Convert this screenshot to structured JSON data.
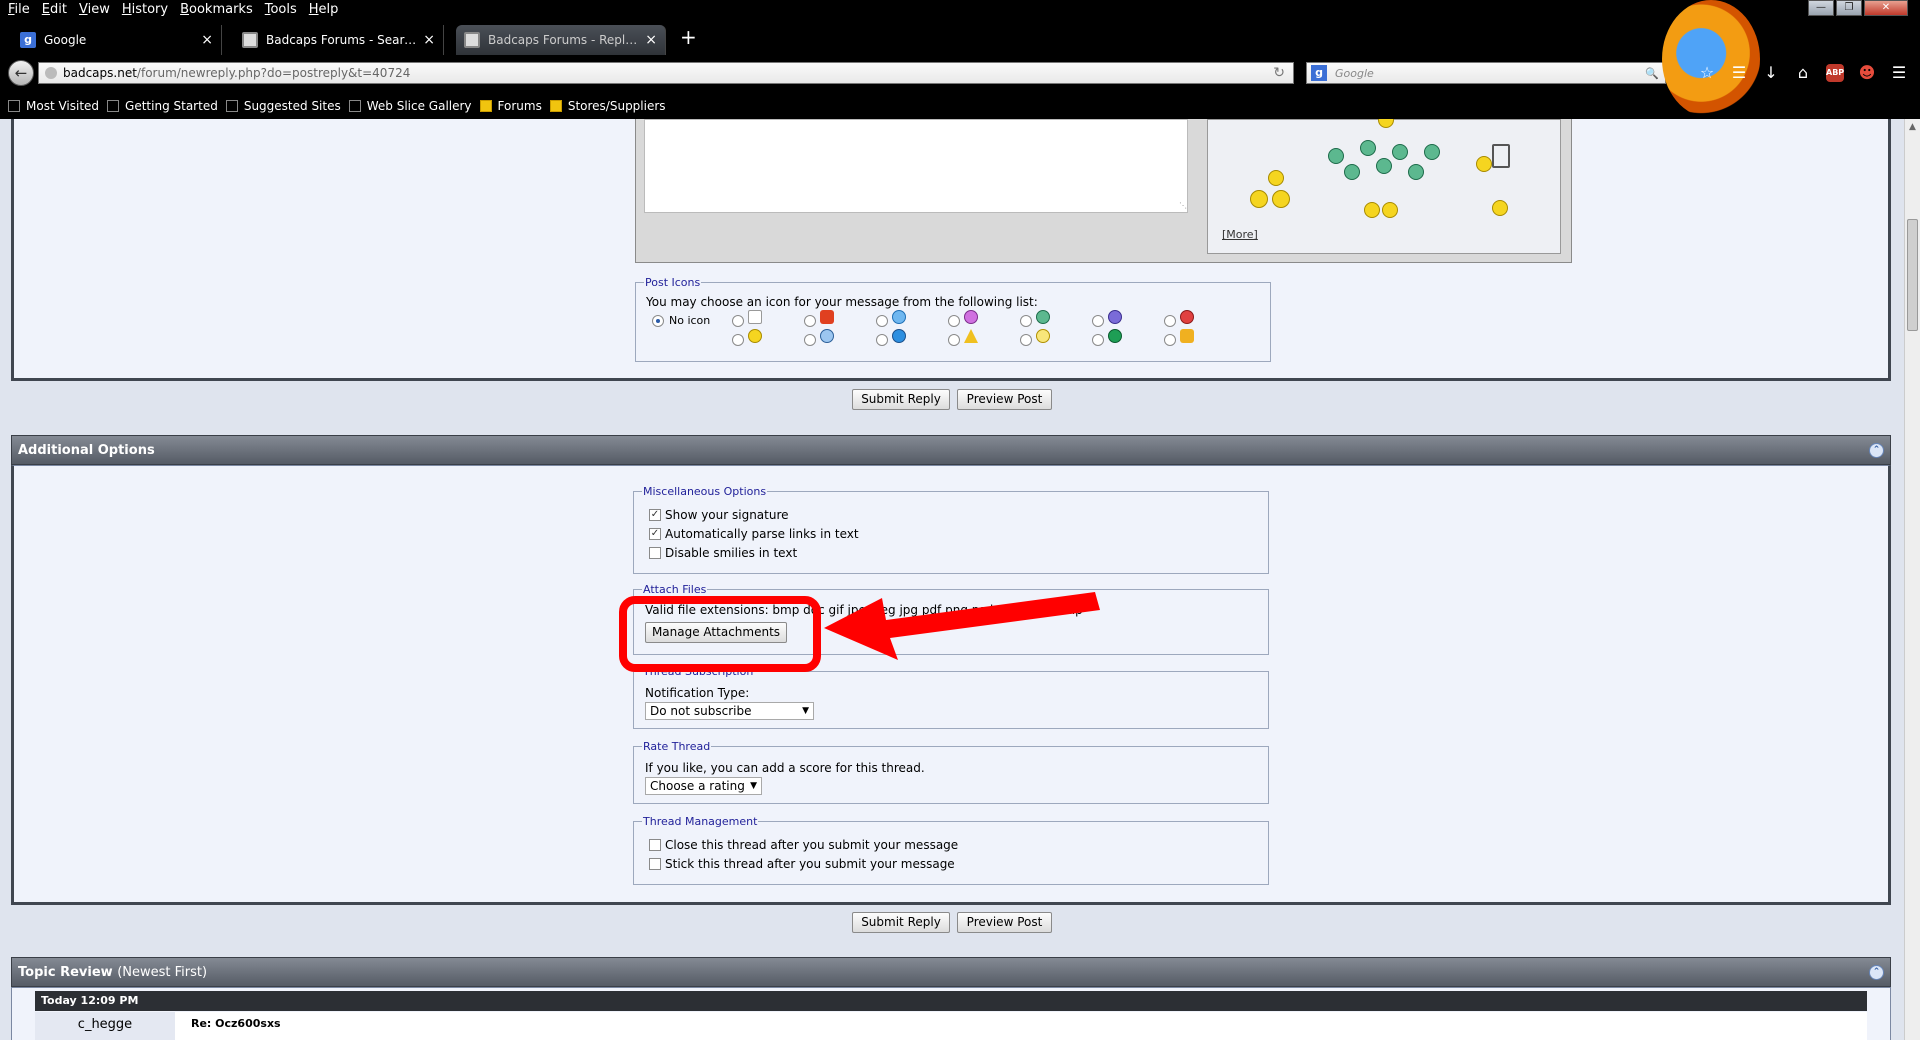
{
  "menubar": {
    "items": [
      {
        "label_u": "F",
        "label_rest": "ile"
      },
      {
        "label_u": "E",
        "label_rest": "dit"
      },
      {
        "label_u": "V",
        "label_rest": "iew"
      },
      {
        "label_u": "H",
        "label_rest": "istory"
      },
      {
        "label_u": "B",
        "label_rest": "ookmarks"
      },
      {
        "label_u": "T",
        "label_rest": "ools"
      },
      {
        "label_u": "H",
        "label_rest": "elp"
      }
    ]
  },
  "tabs": [
    {
      "title": "Google"
    },
    {
      "title": "Badcaps Forums - Search R..."
    },
    {
      "title": "Badcaps Forums - Reply to..."
    }
  ],
  "urlbar": {
    "host": "badcaps.net",
    "path": "/forum/newreply.php?do=postreply&t=40724"
  },
  "searchbar": {
    "placeholder": "Google"
  },
  "bookmarks": [
    "Most Visited",
    "Getting Started",
    "Suggested Sites",
    "Web Slice Gallery",
    "Forums",
    "Stores/Suppliers"
  ],
  "smilies": {
    "more_link": "[More]"
  },
  "post_icons": {
    "legend": "Post Icons",
    "prompt": "You may choose an icon for your message from the following list:",
    "no_icon": "No icon"
  },
  "buttons": {
    "submit": "Submit Reply",
    "preview": "Preview Post"
  },
  "additional": {
    "title": "Additional Options"
  },
  "misc": {
    "legend": "Miscellaneous Options",
    "options": [
      {
        "label": "Show your signature",
        "checked": true
      },
      {
        "label": "Automatically parse links in text",
        "checked": true
      },
      {
        "label": "Disable smilies in text",
        "checked": false
      }
    ]
  },
  "attach": {
    "legend": "Attach Files",
    "valid_label": "Valid file extensions: bmp doc gif jpe jpeg jpg pdf png psd txt xls xlsx zip",
    "manage_button": "Manage Attachments"
  },
  "subscription": {
    "legend": "Thread Subscription",
    "label": "Notification Type:",
    "selected": "Do not subscribe"
  },
  "rate": {
    "legend": "Rate Thread",
    "label": "If you like, you can add a score for this thread.",
    "selected": "Choose a rating"
  },
  "management": {
    "legend": "Thread Management",
    "options": [
      {
        "label": "Close this thread after you submit your message",
        "checked": false
      },
      {
        "label": "Stick this thread after you submit your message",
        "checked": false
      }
    ]
  },
  "topic_review": {
    "title": "Topic Review",
    "subtitle": "(Newest First)",
    "post_date": "Today 12:09 PM",
    "post_author": "c_hegge",
    "post_title": "Re: Ocz600sxs"
  },
  "colors": {
    "highlight": "#ff0000",
    "section_header": "#555b65",
    "legend": "#22229a"
  }
}
